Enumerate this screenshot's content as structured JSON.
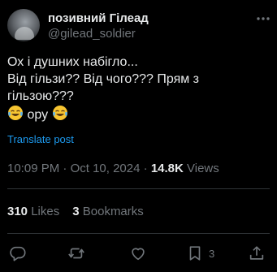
{
  "author": {
    "display_name": "позивний Гілеад",
    "handle": "@gilead_soldier"
  },
  "tweet": {
    "line1": "Ох і душних набігло...",
    "line2": "Від гільзи?? Від чого??? Прям з",
    "line3": "гільзою???",
    "line4_text": " ору ",
    "emoji": "face-with-tears-of-joy-icon"
  },
  "translate_label": "Translate post",
  "meta": {
    "time": "10:09 PM",
    "date": "Oct 10, 2024",
    "separator": "·",
    "views_count": "14.8K",
    "views_label": "Views"
  },
  "stats": {
    "likes_count": "310",
    "likes_label": "Likes",
    "bookmarks_count": "3",
    "bookmarks_label": "Bookmarks"
  },
  "actions": {
    "bookmark_count": "3"
  },
  "colors": {
    "background": "#000000",
    "text": "#e7e9ea",
    "secondary": "#71767b",
    "link": "#1d9bf0",
    "divider": "#2f3336"
  }
}
